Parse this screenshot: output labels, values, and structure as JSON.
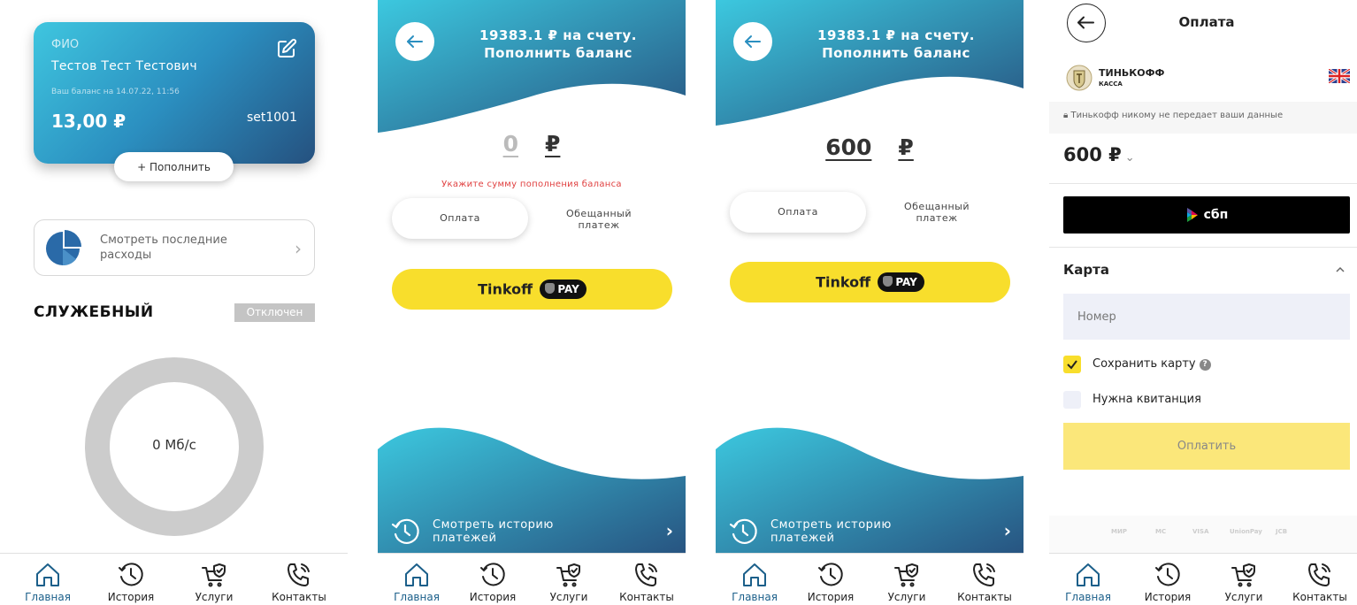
{
  "nav": {
    "home": "Главная",
    "history": "История",
    "services": "Услуги",
    "contacts": "Контакты"
  },
  "screen1": {
    "card": {
      "fio_label": "ФИО",
      "name": "Тестов Тест Тестович",
      "balance_date": "Ваш баланс на 14.07.22, 11:56",
      "balance": "13,00 ₽",
      "login": "set1001"
    },
    "topup_label": "+ Пополнить",
    "expenses_label": "Смотреть последние расходы",
    "service_title": "СЛУЖЕБНЫЙ",
    "service_status": "Отключен",
    "speed": "0 Мб/с"
  },
  "screen2": {
    "title_line1": "19383.1 ₽ на счету.",
    "title_line2": "Пополнить баланс",
    "amount": "0",
    "currency": "₽",
    "error": "Укажите сумму пополнения баланса",
    "tab_pay": "Оплата",
    "tab_promise_line1": "Обещанный",
    "tab_promise_line2": "платеж",
    "tinkoff_label": "Tinkoff",
    "pay_badge": "PAY",
    "history_line1": "Смотреть историю",
    "history_line2": "платежей"
  },
  "screen3": {
    "title_line1": "19383.1 ₽ на счету.",
    "title_line2": "Пополнить баланс",
    "amount": "600",
    "currency": "₽",
    "tab_pay": "Оплата",
    "tab_promise_line1": "Обещанный",
    "tab_promise_line2": "платеж",
    "tinkoff_label": "Tinkoff",
    "pay_badge": "PAY",
    "history_line1": "Смотреть историю",
    "history_line2": "платежей"
  },
  "screen4": {
    "title": "Оплата",
    "brand": "ТИНЬКОФФ",
    "brand_sub": "КАССА",
    "privacy": "Тинькофф никому не передает ваши данные",
    "price": "600 ₽",
    "sbp_label": "сбп",
    "card_section": "Карта",
    "number_placeholder": "Номер",
    "save_card": "Сохранить карту",
    "receipt": "Нужна квитанция",
    "pay_button": "Оплатить",
    "payment_logos": [
      "МИР",
      "MC",
      "VISA",
      "UnionPay",
      "JCB"
    ]
  },
  "colors": {
    "accent_yellow": "#f8de2c",
    "wave_start": "#3cc8df",
    "wave_end": "#27527f"
  }
}
